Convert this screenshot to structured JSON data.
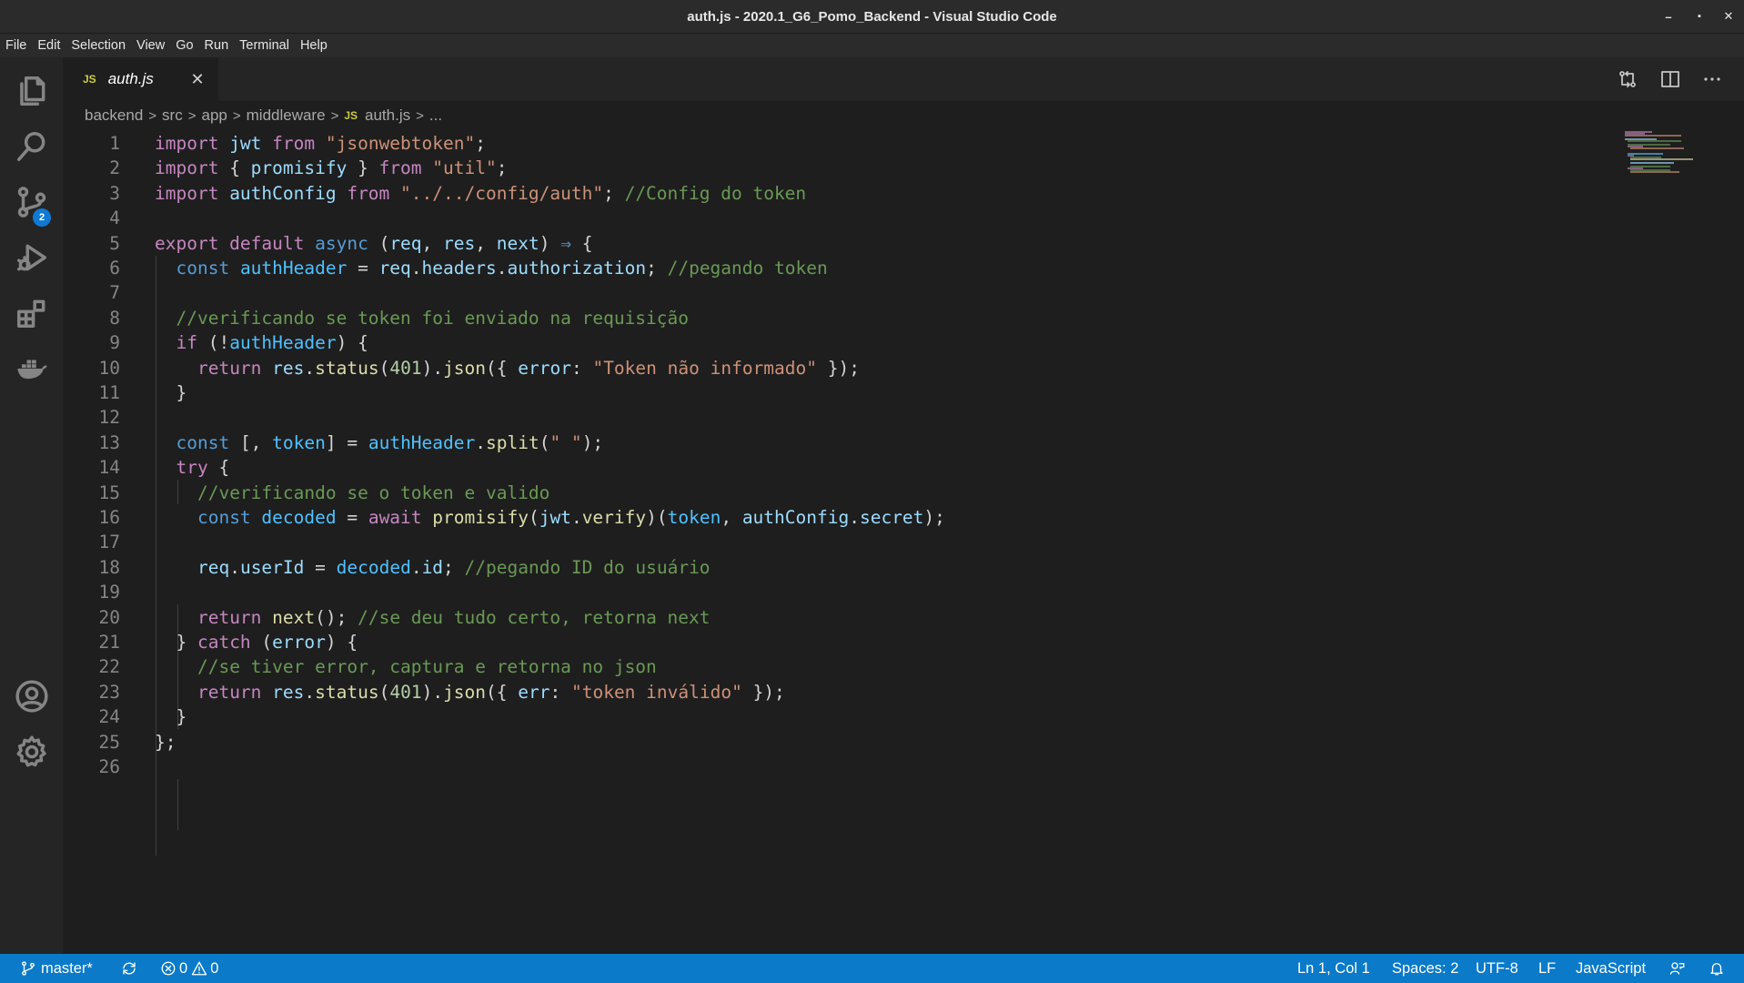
{
  "window": {
    "title": "auth.js - 2020.1_G6_Pomo_Backend - Visual Studio Code",
    "controls": [
      "–",
      "▪",
      "✕"
    ]
  },
  "menu": [
    "File",
    "Edit",
    "Selection",
    "View",
    "Go",
    "Run",
    "Terminal",
    "Help"
  ],
  "activity": {
    "items": [
      "explorer-icon",
      "search-icon",
      "source-control-icon",
      "run-debug-icon",
      "extensions-icon",
      "docker-icon"
    ],
    "source_control_badge": "2",
    "bottom": [
      "account-icon",
      "settings-gear-icon"
    ]
  },
  "tab": {
    "lang_badge": "JS",
    "filename": "auth.js",
    "close": "✕"
  },
  "tab_actions": [
    "compare-changes-icon",
    "split-editor-icon",
    "more-actions-icon"
  ],
  "breadcrumb": {
    "parts": [
      "backend",
      "src",
      "app",
      "middleware"
    ],
    "lang_badge": "JS",
    "file": "auth.js",
    "tail": "..."
  },
  "editor": {
    "line_numbers": [
      "1",
      "2",
      "3",
      "4",
      "5",
      "6",
      "7",
      "8",
      "9",
      "10",
      "11",
      "12",
      "13",
      "14",
      "15",
      "16",
      "17",
      "18",
      "19",
      "20",
      "21",
      "22",
      "23",
      "24",
      "25",
      "26"
    ],
    "lines": [
      [
        [
          "kw",
          "import "
        ],
        [
          "id",
          "jwt "
        ],
        [
          "kw",
          "from "
        ],
        [
          "st",
          "\"jsonwebtoken\""
        ],
        [
          "p",
          ";"
        ]
      ],
      [
        [
          "kw",
          "import "
        ],
        [
          "p",
          "{ "
        ],
        [
          "id",
          "promisify "
        ],
        [
          "p",
          "} "
        ],
        [
          "kw",
          "from "
        ],
        [
          "st",
          "\"util\""
        ],
        [
          "p",
          ";"
        ]
      ],
      [
        [
          "kw",
          "import "
        ],
        [
          "id",
          "authConfig "
        ],
        [
          "kw",
          "from "
        ],
        [
          "st",
          "\"../../config/auth\""
        ],
        [
          "p",
          "; "
        ],
        [
          "co",
          "//Config do token"
        ]
      ],
      [],
      [
        [
          "kw",
          "export default "
        ],
        [
          "st2",
          "async "
        ],
        [
          "p",
          "("
        ],
        [
          "id",
          "req"
        ],
        [
          "p",
          ", "
        ],
        [
          "id",
          "res"
        ],
        [
          "p",
          ", "
        ],
        [
          "id",
          "next"
        ],
        [
          "p",
          ") "
        ],
        [
          "st2",
          "⇒ "
        ],
        [
          "p",
          "{"
        ]
      ],
      [
        [
          "p",
          "  "
        ],
        [
          "st2",
          "const "
        ],
        [
          "cs",
          "authHeader "
        ],
        [
          "p",
          "= "
        ],
        [
          "id",
          "req"
        ],
        [
          "p",
          "."
        ],
        [
          "id",
          "headers"
        ],
        [
          "p",
          "."
        ],
        [
          "id",
          "authorization"
        ],
        [
          "p",
          "; "
        ],
        [
          "co",
          "//pegando token"
        ]
      ],
      [],
      [
        [
          "p",
          "  "
        ],
        [
          "co",
          "//verificando se token foi enviado na requisição"
        ]
      ],
      [
        [
          "p",
          "  "
        ],
        [
          "kw",
          "if "
        ],
        [
          "p",
          "(!"
        ],
        [
          "cs",
          "authHeader"
        ],
        [
          "p",
          ") {"
        ]
      ],
      [
        [
          "p",
          "    "
        ],
        [
          "kw",
          "return "
        ],
        [
          "id",
          "res"
        ],
        [
          "p",
          "."
        ],
        [
          "fn",
          "status"
        ],
        [
          "p",
          "("
        ],
        [
          "num",
          "401"
        ],
        [
          "p",
          ")."
        ],
        [
          "fn",
          "json"
        ],
        [
          "p",
          "({ "
        ],
        [
          "id",
          "error"
        ],
        [
          "p",
          ": "
        ],
        [
          "st",
          "\"Token não informado\""
        ],
        [
          "p",
          " });"
        ]
      ],
      [
        [
          "p",
          "  }"
        ]
      ],
      [],
      [
        [
          "p",
          "  "
        ],
        [
          "st2",
          "const "
        ],
        [
          "p",
          "[, "
        ],
        [
          "cs",
          "token"
        ],
        [
          "p",
          "] = "
        ],
        [
          "cs",
          "authHeader"
        ],
        [
          "p",
          "."
        ],
        [
          "fn",
          "split"
        ],
        [
          "p",
          "("
        ],
        [
          "st",
          "\" \""
        ],
        [
          "p",
          ");"
        ]
      ],
      [
        [
          "p",
          "  "
        ],
        [
          "kw",
          "try "
        ],
        [
          "p",
          "{"
        ]
      ],
      [
        [
          "p",
          "    "
        ],
        [
          "co",
          "//verificando se o token e valido"
        ]
      ],
      [
        [
          "p",
          "    "
        ],
        [
          "st2",
          "const "
        ],
        [
          "cs",
          "decoded "
        ],
        [
          "p",
          "= "
        ],
        [
          "kw",
          "await "
        ],
        [
          "fn",
          "promisify"
        ],
        [
          "p",
          "("
        ],
        [
          "id",
          "jwt"
        ],
        [
          "p",
          "."
        ],
        [
          "fn",
          "verify"
        ],
        [
          "p",
          ")("
        ],
        [
          "cs",
          "token"
        ],
        [
          "p",
          ", "
        ],
        [
          "id",
          "authConfig"
        ],
        [
          "p",
          "."
        ],
        [
          "id",
          "secret"
        ],
        [
          "p",
          ");"
        ]
      ],
      [],
      [
        [
          "p",
          "    "
        ],
        [
          "id",
          "req"
        ],
        [
          "p",
          "."
        ],
        [
          "id",
          "userId "
        ],
        [
          "p",
          "= "
        ],
        [
          "cs",
          "decoded"
        ],
        [
          "p",
          "."
        ],
        [
          "id",
          "id"
        ],
        [
          "p",
          "; "
        ],
        [
          "co",
          "//pegando ID do usuário"
        ]
      ],
      [],
      [
        [
          "p",
          "    "
        ],
        [
          "kw",
          "return "
        ],
        [
          "fn",
          "next"
        ],
        [
          "p",
          "(); "
        ],
        [
          "co",
          "//se deu tudo certo, retorna next"
        ]
      ],
      [
        [
          "p",
          "  } "
        ],
        [
          "kw",
          "catch "
        ],
        [
          "p",
          "("
        ],
        [
          "id",
          "error"
        ],
        [
          "p",
          ") {"
        ]
      ],
      [
        [
          "p",
          "    "
        ],
        [
          "co",
          "//se tiver error, captura e retorna no json"
        ]
      ],
      [
        [
          "p",
          "    "
        ],
        [
          "kw",
          "return "
        ],
        [
          "id",
          "res"
        ],
        [
          "p",
          "."
        ],
        [
          "fn",
          "status"
        ],
        [
          "p",
          "("
        ],
        [
          "num",
          "401"
        ],
        [
          "p",
          ")."
        ],
        [
          "fn",
          "json"
        ],
        [
          "p",
          "({ "
        ],
        [
          "id",
          "err"
        ],
        [
          "p",
          ": "
        ],
        [
          "st",
          "\"token inválido\""
        ],
        [
          "p",
          " });"
        ]
      ],
      [
        [
          "p",
          "  }"
        ]
      ],
      [
        [
          "p",
          "};"
        ]
      ],
      []
    ]
  },
  "status": {
    "branch": "master*",
    "errors": "0",
    "warnings": "0",
    "position": "Ln 1, Col 1",
    "indent": "Spaces: 2",
    "encoding": "UTF-8",
    "eol": "LF",
    "language": "JavaScript"
  },
  "colors": {
    "statusbar": "#0a7ac9",
    "editor_bg": "#1e1e1e",
    "keyword": "#c586c0",
    "string": "#ce9178",
    "comment": "#6a9955"
  }
}
